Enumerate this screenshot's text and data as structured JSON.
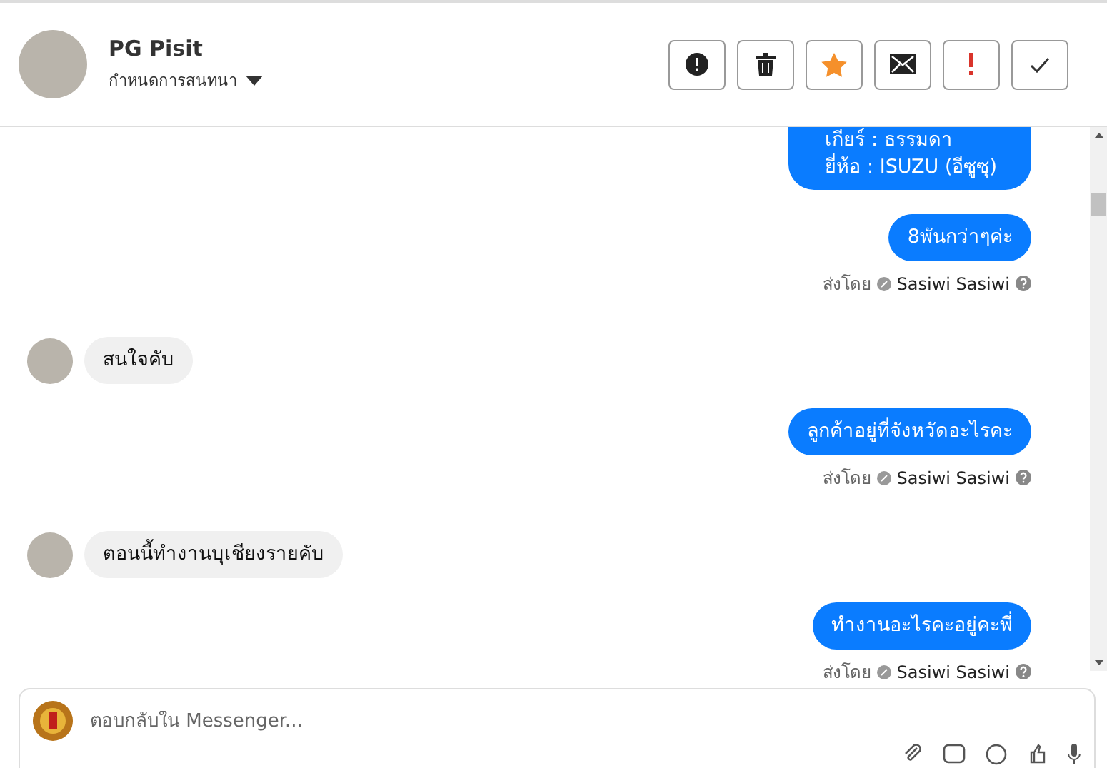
{
  "header": {
    "name": "PG Pisit",
    "subtitle": "กำหนดการสนทนา"
  },
  "actions": [
    {
      "kind": "alert"
    },
    {
      "kind": "trash"
    },
    {
      "kind": "star"
    },
    {
      "kind": "mail"
    },
    {
      "kind": "exclaim"
    },
    {
      "kind": "check"
    }
  ],
  "messages": [
    {
      "kind": "outgoing",
      "lines": [
        "เกียร์ : ธรรมดา",
        "ยี่ห้อ : ISUZU (อีซูซุ)"
      ],
      "clipped": true
    },
    {
      "kind": "outgoing",
      "lines": [
        "8พันกว่าๆค่ะ"
      ],
      "sent_by_label": "ส่งโดย",
      "sender": "Sasiwi Sasiwi"
    },
    {
      "kind": "incoming",
      "lines": [
        "สนใจคับ"
      ]
    },
    {
      "kind": "outgoing",
      "lines": [
        "ลูกค้าอยู่ที่จังหวัดอะไรคะ"
      ],
      "sent_by_label": "ส่งโดย",
      "sender": "Sasiwi Sasiwi"
    },
    {
      "kind": "incoming",
      "lines": [
        "ตอนนี้ทำงานบุเชียงรายคับ"
      ]
    },
    {
      "kind": "outgoing",
      "lines": [
        "ทำงานอะไรคะอยู่คะพี่"
      ],
      "sent_by_label": "ส่งโดย",
      "sender": "Sasiwi Sasiwi"
    }
  ],
  "composer": {
    "placeholder": "ตอบกลับใน Messenger..."
  }
}
